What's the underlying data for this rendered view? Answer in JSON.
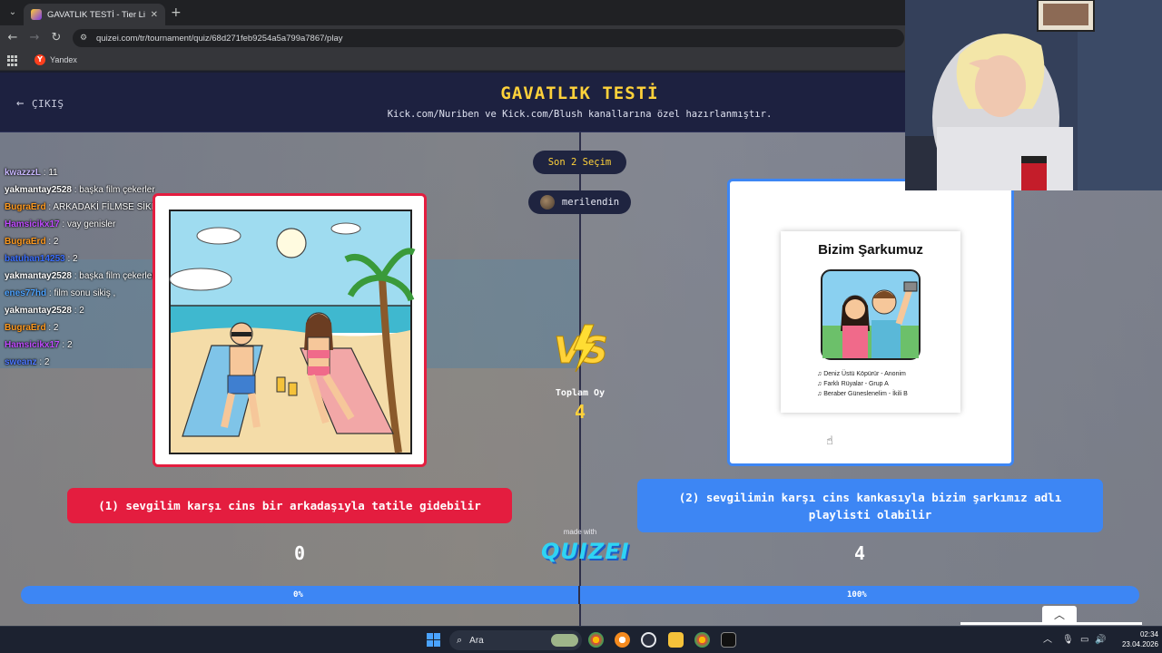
{
  "browser": {
    "tab_title": "GAVATLIK TESTİ - Tier List, Kör S",
    "tab_close": "✕",
    "new_tab": "+",
    "url": "quizei.com/tr/tournament/quiz/68d271feb9254a5a799a7867/play",
    "bookmark": "Yandex",
    "bookmark_badge": "Y"
  },
  "header": {
    "exit_label": "ÇIKIŞ",
    "title": "GAVATLIK TESTİ",
    "subtitle": "Kick.com/Nuriben ve Kick.com/Blush kanallarına özel hazırlanmıştır."
  },
  "chat": [
    {
      "user": "kwazzzL",
      "msg": " : 11",
      "color": "#c9b8ff"
    },
    {
      "user": "yakmantay2528",
      "msg": " : başka film çekerler",
      "color": "#ffffff"
    },
    {
      "user": "BugraErd",
      "msg": " : ARKADAKİ FİLMSE SİKERİM O ADAMI",
      "color": "#ff9a1f"
    },
    {
      "user": "Hamsicikx17",
      "msg": " : vay genisler",
      "color": "#c04cff"
    },
    {
      "user": "BugraErd",
      "msg": " : 2",
      "color": "#ff9a1f"
    },
    {
      "user": "batuhan14253",
      "msg": " : 2",
      "color": "#3b6fff"
    },
    {
      "user": "yakmantay2528",
      "msg": " : başka film çekerler",
      "color": "#ffffff"
    },
    {
      "user": "enes77hd",
      "msg": " : film sonu sikiş ,",
      "color": "#4da3ff"
    },
    {
      "user": "yakmantay2528",
      "msg": " : 2",
      "color": "#ffffff"
    },
    {
      "user": "BugraErd",
      "msg": " : 2",
      "color": "#ff9a1f"
    },
    {
      "user": "Hamsicikx17",
      "msg": " : 2",
      "color": "#c04cff"
    },
    {
      "user": "sweanz",
      "msg": " : 2",
      "color": "#4d78ff"
    }
  ],
  "match": {
    "last_choice": "Son 2 Seçim",
    "voter": "merilendin",
    "total_label": "Toplam Oy",
    "total_votes": "4",
    "left": {
      "label": "(1) sevgilim karşı cins bir arkadaşıyla tatile gidebilir",
      "score": "0",
      "percent_label": "0%",
      "share": 0
    },
    "right": {
      "label": "(2) sevgilimin karşı cins kankasıyla bizim şarkımız adlı playlisti olabilir",
      "score": "4",
      "percent_label": "100%",
      "share": 1,
      "card_title": "Bizim Şarkumuz",
      "songs": [
        "Deniz Üstü Köpürür - Anonim",
        "Farklı Rüyalar - Grup A",
        "Beraber Güneslenelim - İkili B"
      ]
    },
    "made_with": "made with",
    "brand": "QUIZEI"
  },
  "taskbar": {
    "search_label": "Ara",
    "time": "02:34",
    "date": "23.04.2026"
  },
  "colors": {
    "left_accent": "#e41d3f",
    "right_accent": "#3d86f4",
    "title_yellow": "#ffd23a"
  }
}
